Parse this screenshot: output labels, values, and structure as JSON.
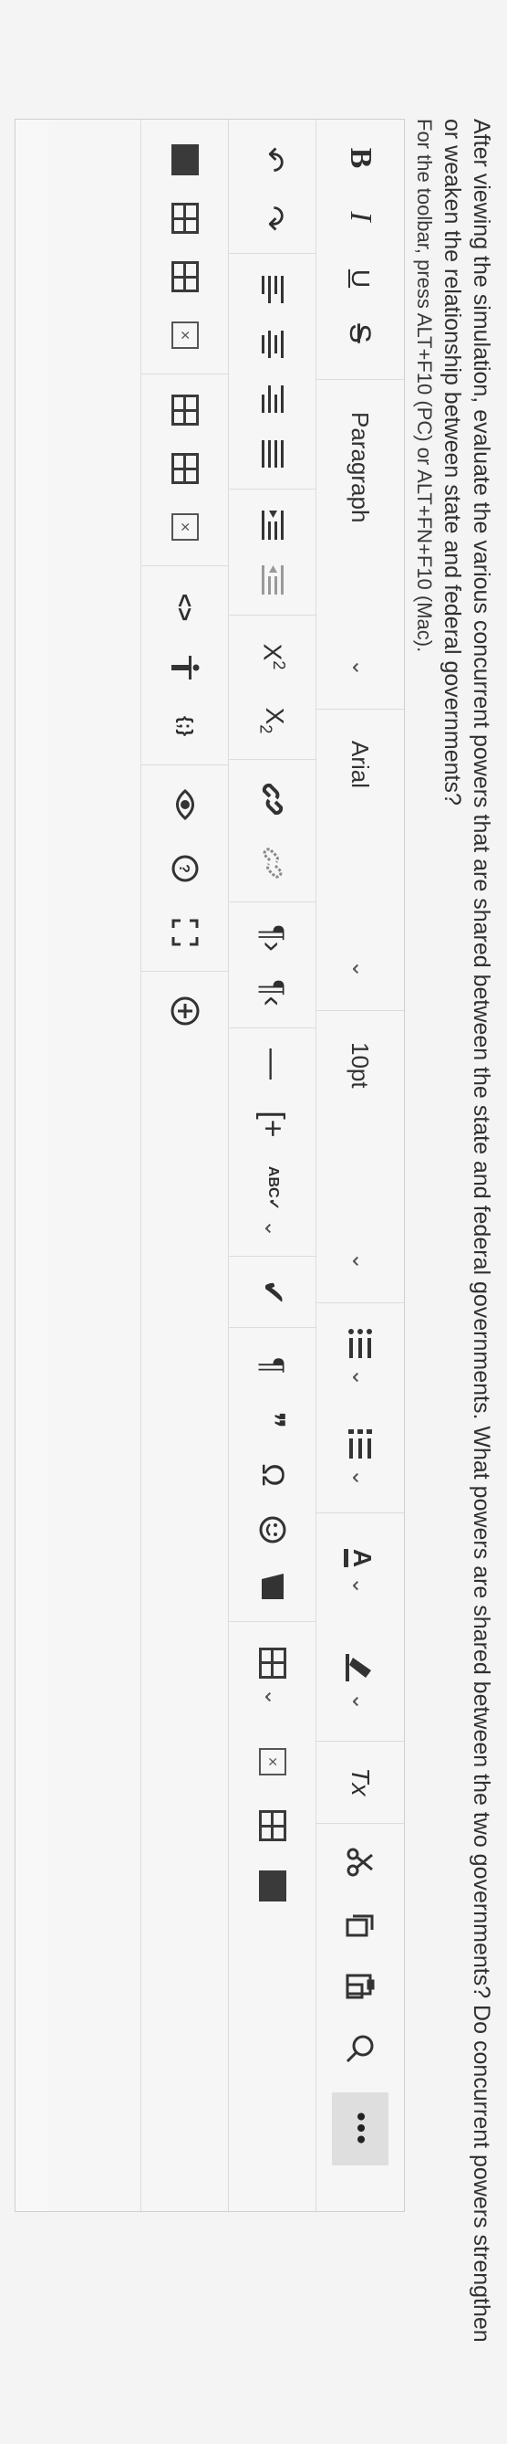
{
  "question": {
    "text": "After viewing the simulation, evaluate the various concurrent powers that are shared between the state and federal governments. What powers are shared between the two governments? Do concurrent powers strengthen or weaken the relationship between state and federal governments?",
    "toolbar_hint": "For the toolbar, press ALT+F10 (PC) or ALT+FN+F10 (Mac)."
  },
  "toolbar": {
    "bold": "B",
    "italic": "I",
    "underline": "U",
    "strikethrough": "S",
    "paragraph_format": "Paragraph",
    "font_family": "Arial",
    "font_size": "10pt",
    "more": "•••",
    "superscript": "X",
    "superscript_mark": "2",
    "subscript": "X",
    "subscript_mark": "2",
    "text_color": "A",
    "clear_formatting": "Tx",
    "code_inline": "<>",
    "code_block": "{;}",
    "pilcrow": "¶",
    "quote": "❞",
    "omega": "Ω",
    "chevron": "⌄",
    "undo": "↶",
    "redo": "↷",
    "plus": "+",
    "horizontal_rule": "—"
  },
  "icons": [
    "bold-icon",
    "italic-icon",
    "underline-icon",
    "strikethrough-icon",
    "list-icon",
    "numbered-list-icon",
    "text-color-icon",
    "highlight-icon",
    "clear-format-icon",
    "cut-icon",
    "copy-icon",
    "paste-icon",
    "search-icon",
    "undo-icon",
    "redo-icon",
    "align-icon",
    "indent-icon",
    "link-icon",
    "unlink-icon",
    "ltr-icon",
    "rtl-icon",
    "table-icon",
    "special-char-icon",
    "emoji-icon",
    "media-icon",
    "fullscreen-icon",
    "add-icon"
  ]
}
